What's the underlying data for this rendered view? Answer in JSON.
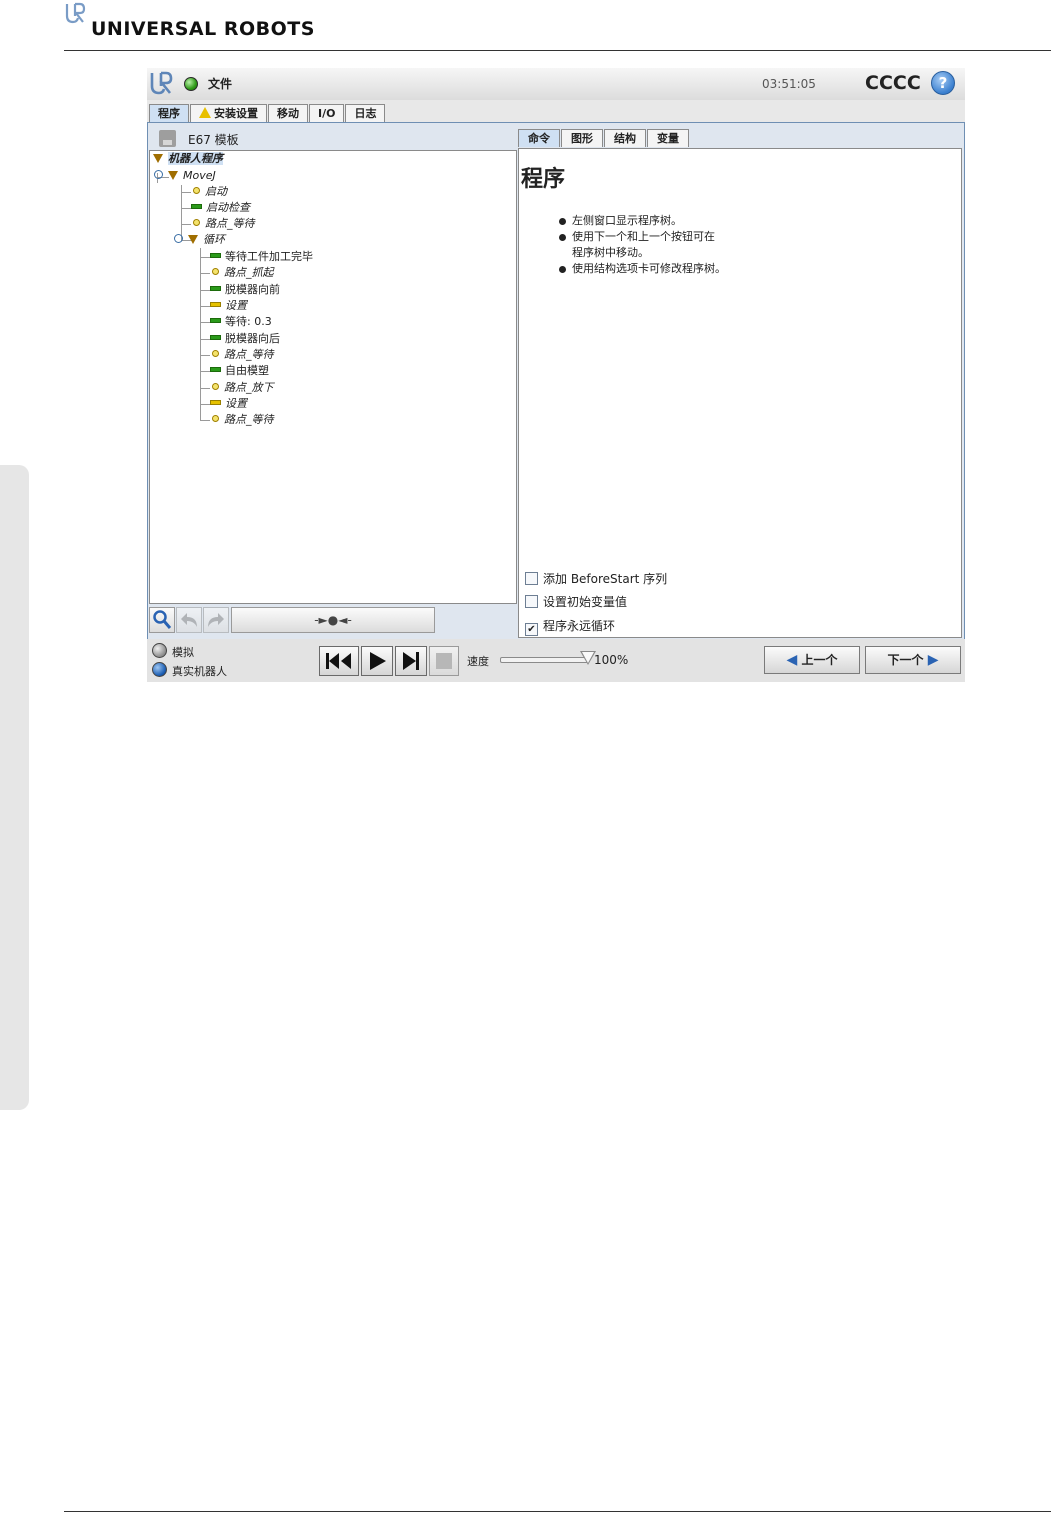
{
  "doc": {
    "brand": "UNIVERSAL ROBOTS"
  },
  "titlebar": {
    "file_menu": "文件",
    "clock": "03:51:05",
    "robot_name": "CCCC",
    "help": "?"
  },
  "main_tabs": [
    {
      "label": "程序",
      "active": true
    },
    {
      "label": "安装设置",
      "warning": true
    },
    {
      "label": "移动"
    },
    {
      "label": "I/O"
    },
    {
      "label": "日志"
    }
  ],
  "program": {
    "name": "E67 模板"
  },
  "tree": [
    {
      "label": "机器人程序"
    },
    {
      "label": "MoveJ"
    },
    {
      "label": "启动"
    },
    {
      "label": "启动检查"
    },
    {
      "label": "路点_等待"
    },
    {
      "label": "循环"
    },
    {
      "label": "等待工件加工完毕"
    },
    {
      "label": "路点_抓起"
    },
    {
      "label": "脱模器向前"
    },
    {
      "label": "设置"
    },
    {
      "label": "等待: 0.3"
    },
    {
      "label": "脱模器向后"
    },
    {
      "label": "路点_等待"
    },
    {
      "label": "自由模塑"
    },
    {
      "label": "路点_放下"
    },
    {
      "label": "设置"
    },
    {
      "label": "路点_等待"
    }
  ],
  "left_toolbar": {
    "wide_button": "-►●◄-"
  },
  "sub_tabs": [
    {
      "label": "命令",
      "active": true
    },
    {
      "label": "图形"
    },
    {
      "label": "结构"
    },
    {
      "label": "变量"
    }
  ],
  "command": {
    "title": "程序",
    "bullets": [
      "左侧窗口显示程序树。",
      "使用下一个和上一个按钮可在",
      "程序树中移动。",
      "使用结构选项卡可修改程序树。"
    ],
    "options": [
      {
        "label": "添加 BeforeStart 序列",
        "checked": false
      },
      {
        "label": "设置初始变量值",
        "checked": false
      },
      {
        "label": "程序永远循环",
        "checked": true
      }
    ]
  },
  "bottom": {
    "mode_sim": "模拟",
    "mode_real": "真实机器人",
    "speed_label": "速度",
    "speed_value": "100%",
    "speed_fraction": 1.0,
    "prev_label": "上一个",
    "next_label": "下一个"
  },
  "colors": {
    "accent_blue": "#2a63b3",
    "status_green": "#2f9a18",
    "warning_yellow": "#e8c000",
    "selection": "#cfe0f3"
  }
}
